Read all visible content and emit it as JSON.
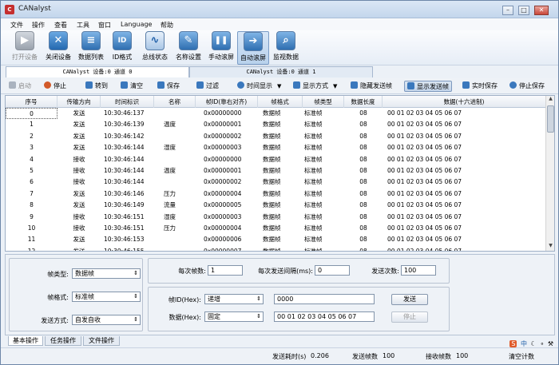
{
  "window": {
    "title": "CANalyst",
    "icon": "can-app-icon",
    "controls": [
      "–",
      "□",
      "✕"
    ]
  },
  "menu": [
    "文件",
    "操作",
    "查看",
    "工具",
    "窗口",
    "Language",
    "帮助"
  ],
  "toolbar": [
    {
      "label": "打开设备",
      "icon": "open-device-icon",
      "glyph": "▶",
      "disabled": true
    },
    {
      "label": "关闭设备",
      "icon": "close-device-icon",
      "glyph": "✕"
    },
    {
      "label": "数据列表",
      "icon": "database-icon",
      "glyph": "≡"
    },
    {
      "label": "ID格式",
      "icon": "id-format-icon",
      "glyph": "ID"
    },
    {
      "label": "总线状态",
      "icon": "bus-status-icon",
      "glyph": "∿"
    },
    {
      "label": "名称设置",
      "icon": "name-settings-icon",
      "glyph": "✎"
    },
    {
      "label": "手动滚屏",
      "icon": "manual-scroll-icon",
      "glyph": "❚❚"
    },
    {
      "label": "自动滚屏",
      "icon": "auto-scroll-icon",
      "glyph": "➔",
      "active": true
    },
    {
      "label": "监视数据",
      "icon": "monitor-search-icon",
      "glyph": "⌕"
    }
  ],
  "device_tabs": [
    "CANalyst 设备:0 通道 0",
    "CANalyst 设备:0 通道 1"
  ],
  "actions": {
    "start": "启动",
    "stop": "停止",
    "goto": "转到",
    "clear": "清空",
    "save": "保存",
    "filter": "过滤",
    "time_display": "时间显示",
    "display_mode": "显示方式",
    "hide_send": "隐藏发送帧",
    "show_send": "显示发送帧",
    "realtime_save": "实时保存",
    "stop_save": "停止保存"
  },
  "table": {
    "headers": [
      "序号",
      "传输方向",
      "时间标识",
      "名称",
      "帧ID(靠右对齐)",
      "帧格式",
      "帧类型",
      "数据长度",
      "数据(十六进制)"
    ],
    "rows": [
      [
        "0",
        "发送",
        "10:30:46:137",
        "",
        "0x00000000",
        "数据帧",
        "标准帧",
        "08",
        "00 01 02 03 04 05 06 07"
      ],
      [
        "1",
        "发送",
        "10:30:46:139",
        "温度",
        "0x00000001",
        "数据帧",
        "标准帧",
        "08",
        "00 01 02 03 04 05 06 07"
      ],
      [
        "2",
        "发送",
        "10:30:46:142",
        "",
        "0x00000002",
        "数据帧",
        "标准帧",
        "08",
        "00 01 02 03 04 05 06 07"
      ],
      [
        "3",
        "发送",
        "10:30:46:144",
        "湿度",
        "0x00000003",
        "数据帧",
        "标准帧",
        "08",
        "00 01 02 03 04 05 06 07"
      ],
      [
        "4",
        "接收",
        "10:30:46:144",
        "",
        "0x00000000",
        "数据帧",
        "标准帧",
        "08",
        "00 01 02 03 04 05 06 07"
      ],
      [
        "5",
        "接收",
        "10:30:46:144",
        "温度",
        "0x00000001",
        "数据帧",
        "标准帧",
        "08",
        "00 01 02 03 04 05 06 07"
      ],
      [
        "6",
        "接收",
        "10:30:46:144",
        "",
        "0x00000002",
        "数据帧",
        "标准帧",
        "08",
        "00 01 02 03 04 05 06 07"
      ],
      [
        "7",
        "发送",
        "10:30:46:146",
        "压力",
        "0x00000004",
        "数据帧",
        "标准帧",
        "08",
        "00 01 02 03 04 05 06 07"
      ],
      [
        "8",
        "发送",
        "10:30:46:149",
        "流量",
        "0x00000005",
        "数据帧",
        "标准帧",
        "08",
        "00 01 02 03 04 05 06 07"
      ],
      [
        "9",
        "接收",
        "10:30:46:151",
        "湿度",
        "0x00000003",
        "数据帧",
        "标准帧",
        "08",
        "00 01 02 03 04 05 06 07"
      ],
      [
        "10",
        "接收",
        "10:30:46:151",
        "压力",
        "0x00000004",
        "数据帧",
        "标准帧",
        "08",
        "00 01 02 03 04 05 06 07"
      ],
      [
        "11",
        "发送",
        "10:30:46:153",
        "",
        "0x00000006",
        "数据帧",
        "标准帧",
        "08",
        "00 01 02 03 04 05 06 07"
      ],
      [
        "12",
        "发送",
        "10:30:46:155",
        "",
        "0x00000007",
        "数据帧",
        "标准帧",
        "08",
        "00 01 02 03 04 05 06 07"
      ]
    ]
  },
  "send_panel": {
    "frame_type_label": "帧类型:",
    "frame_type": "数据帧",
    "frame_format_label": "帧格式:",
    "frame_format": "标准帧",
    "send_mode_label": "发送方式:",
    "send_mode": "自发自收",
    "frames_per_send_label": "每次帧数:",
    "frames_per_send": "1",
    "interval_label": "每次发送间隔(ms):",
    "interval": "0",
    "send_count_label": "发送次数:",
    "send_count": "100",
    "frame_id_label": "帧ID(Hex):",
    "frame_id_mode": "递增",
    "frame_id": "0000",
    "data_label": "数据(Hex):",
    "data_mode": "固定",
    "data": "00 01 02 03 04 05 06 07",
    "send_button": "发送",
    "stop_button": "停止"
  },
  "bottom_tabs": [
    "基本操作",
    "任务操作",
    "文件操作"
  ],
  "status": {
    "send_time_label": "发送耗时(s)",
    "send_time": "0.206",
    "sent_label": "发送帧数",
    "sent": "100",
    "recv_label": "接收帧数",
    "recv": "100",
    "clear_count": "清空计数"
  },
  "tray": {
    "ime_logo": "S",
    "lang": "中"
  }
}
